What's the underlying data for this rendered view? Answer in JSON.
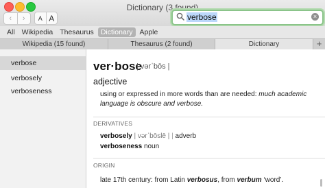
{
  "window": {
    "title": "Dictionary (3 found)"
  },
  "toolbar": {
    "back_glyph": "‹",
    "forward_glyph": "›",
    "font_smaller": "A",
    "font_larger": "A"
  },
  "search": {
    "value": "verbose",
    "clear_glyph": "×"
  },
  "scopes": [
    {
      "label": "All"
    },
    {
      "label": "Wikipedia"
    },
    {
      "label": "Thesaurus"
    },
    {
      "label": "Dictionary",
      "active": true
    },
    {
      "label": "Apple"
    }
  ],
  "tabs": [
    {
      "label": "Wikipedia (15 found)"
    },
    {
      "label": "Thesaurus (2 found)"
    },
    {
      "label": "Dictionary",
      "active": true
    },
    {
      "label": "+"
    }
  ],
  "sidebar": {
    "items": [
      {
        "label": "verbose",
        "selected": true
      },
      {
        "label": "verbosely"
      },
      {
        "label": "verboseness"
      }
    ]
  },
  "entry": {
    "headword": "ver·bose",
    "pronunciation": "| vərˈbōs |",
    "part_of_speech": "adjective",
    "definition": "using or expressed in more words than are needed: ",
    "example": "much academic language is obscure and verbose.",
    "derivatives_label": "DERIVATIVES",
    "derivatives": [
      {
        "word": "verbosely",
        "pron": "| vərˈbōslē |",
        "pos": "adverb"
      },
      {
        "word": "verboseness",
        "pos": "noun"
      }
    ],
    "origin_label": "ORIGIN",
    "origin": {
      "t1": "late 17th century: from Latin ",
      "w1": "verbosus",
      "t2": ", from ",
      "w2": "verbum",
      "t3": " ‘word’."
    }
  },
  "colors": {
    "search_focus": "#8bc48a",
    "scope_active": "#b3b3b3",
    "sidebar_selected": "#d7d7d7"
  }
}
